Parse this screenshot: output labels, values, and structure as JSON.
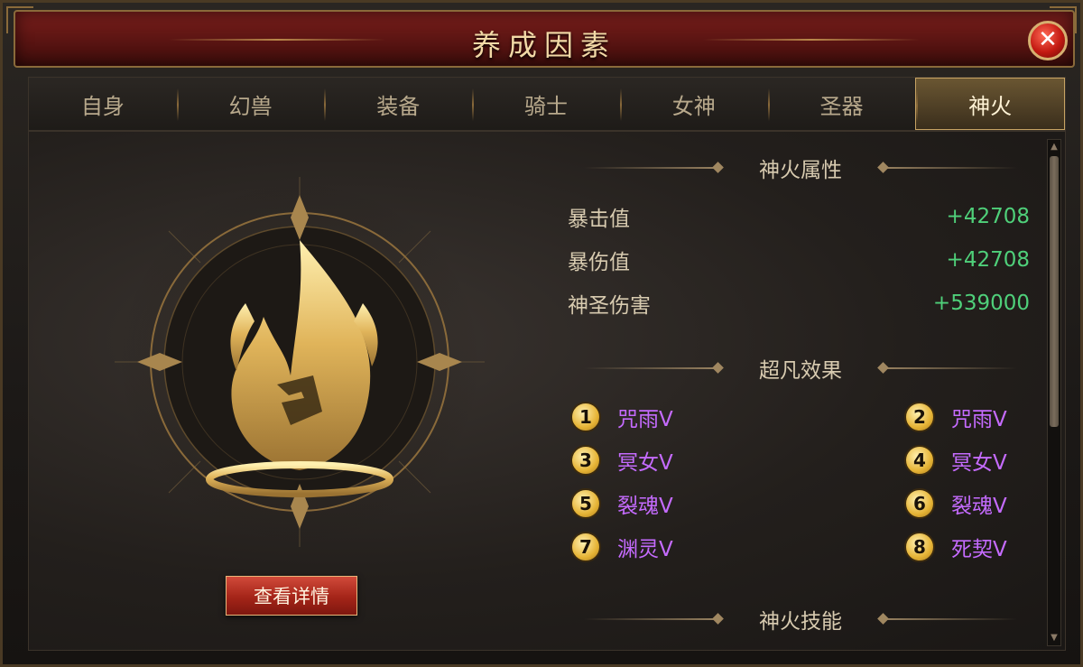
{
  "window": {
    "title": "养成因素",
    "close_glyph": "✕"
  },
  "tabs": [
    {
      "label": "自身"
    },
    {
      "label": "幻兽"
    },
    {
      "label": "装备"
    },
    {
      "label": "骑士"
    },
    {
      "label": "女神"
    },
    {
      "label": "圣器"
    },
    {
      "label": "神火",
      "active": true
    }
  ],
  "left_panel": {
    "emblem_icon": "golden-flame-emblem-icon",
    "detail_button_label": "查看详情"
  },
  "attributes": {
    "heading": "神火属性",
    "rows": [
      {
        "name": "暴击值",
        "value": "+42708"
      },
      {
        "name": "暴伤值",
        "value": "+42708"
      },
      {
        "name": "神圣伤害",
        "value": "+539000"
      }
    ]
  },
  "effects": {
    "heading": "超凡效果",
    "items": [
      {
        "num": "1",
        "label": "咒雨Ⅴ"
      },
      {
        "num": "2",
        "label": "咒雨Ⅴ"
      },
      {
        "num": "3",
        "label": "冥女Ⅴ"
      },
      {
        "num": "4",
        "label": "冥女Ⅴ"
      },
      {
        "num": "5",
        "label": "裂魂Ⅴ"
      },
      {
        "num": "6",
        "label": "裂魂Ⅴ"
      },
      {
        "num": "7",
        "label": "渊灵Ⅴ"
      },
      {
        "num": "8",
        "label": "死契Ⅴ"
      }
    ]
  },
  "skills": {
    "heading": "神火技能"
  },
  "colors": {
    "accent_gold": "#c7a363",
    "stat_green": "#4fd07a",
    "effect_purple": "#c56bff",
    "title_red": "#7b1f1c"
  }
}
